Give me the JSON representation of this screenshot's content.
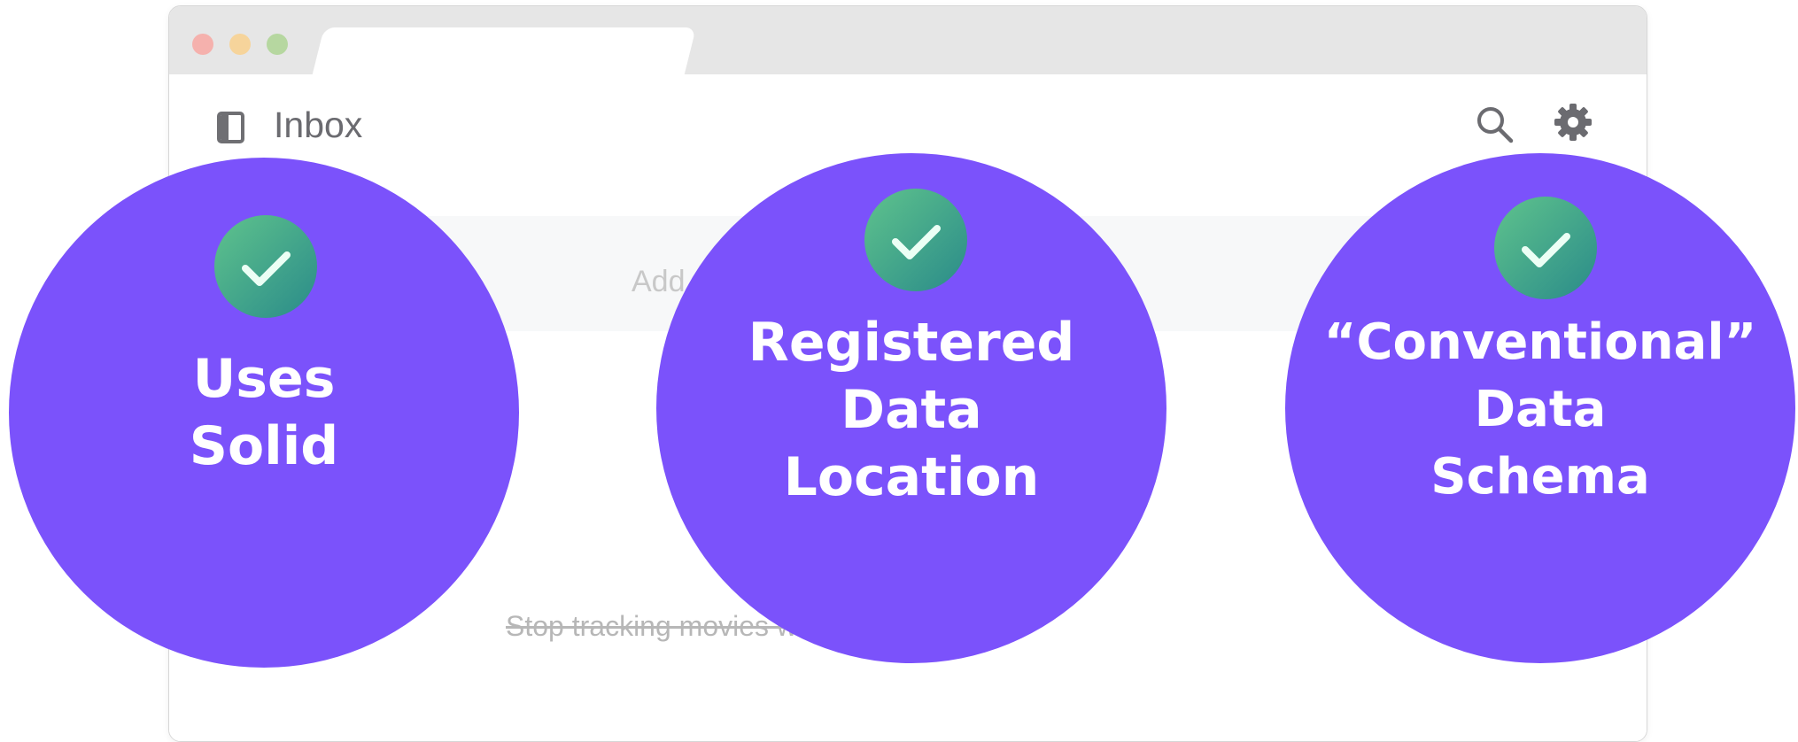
{
  "app": {
    "title": "Inbox",
    "task_placeholder": "Add a new task",
    "task_item": "Stop tracking movies with Media Kraken"
  },
  "icons": {
    "sidebar": "sidebar-toggle-icon",
    "search": "search-icon",
    "settings": "gear-icon",
    "check": "check-icon"
  },
  "colors": {
    "badge": "#7b52fb",
    "check_start": "#5fc38c",
    "check_end": "#2a8b8a"
  },
  "badges": [
    {
      "line1": "Uses",
      "line2": "Solid"
    },
    {
      "line1": "Registered",
      "line2": "Data",
      "line3": "Location"
    },
    {
      "line1": "“Conventional”",
      "line2": "Data",
      "line3": "Schema"
    }
  ]
}
